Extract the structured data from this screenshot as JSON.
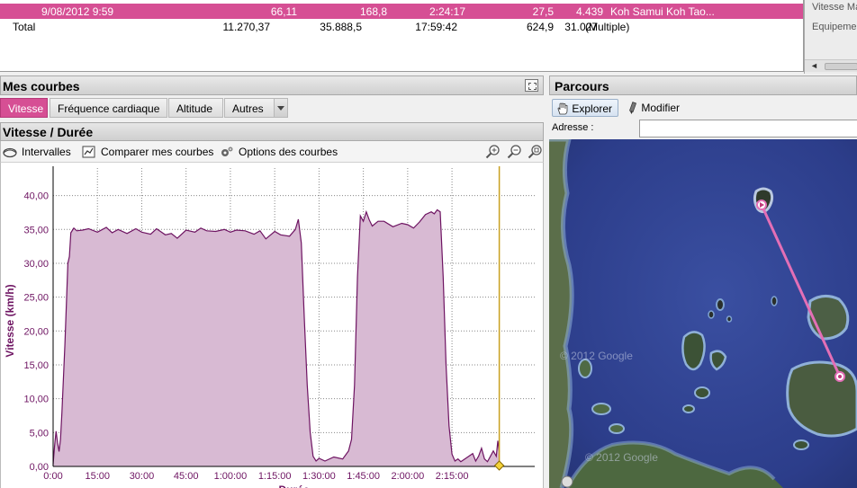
{
  "table": {
    "selected_row": {
      "date": "9/08/2012 9:59",
      "c1": "66,11",
      "c2": "168,8",
      "c3": "2:24:17",
      "c4": "27,5",
      "c5": "4.439",
      "c6": "Koh Samui  Koh Tao..."
    },
    "total_row": {
      "label": "Total",
      "c1": "11.270,37",
      "c2": "35.888,5",
      "c3": "17:59:42",
      "c4": "624,9",
      "c5": "31.027",
      "c6": "(Multiple)"
    }
  },
  "side_panel": {
    "label1": "Vitesse Ma",
    "label2": "Equipemen"
  },
  "mes_courbes": {
    "title": "Mes courbes",
    "tabs": [
      "Vitesse",
      "Fréquence cardiaque",
      "Altitude",
      "Autres"
    ]
  },
  "chart_panel": {
    "title": "Vitesse / Durée",
    "toolbar": {
      "intervalles": "Intervalles",
      "comparer": "Comparer mes courbes",
      "options": "Options des courbes"
    }
  },
  "parcours": {
    "title": "Parcours",
    "explorer": "Explorer",
    "modifier": "Modifier",
    "adresse_label": "Adresse :",
    "adresse_value": "",
    "watermark1": "© 2012 Google",
    "watermark2": "© 2012 Google"
  },
  "colors": {
    "accent": "#d64f94",
    "series_line": "#6e1462",
    "series_fill": "#d8bad3",
    "axis_text": "#6e1462",
    "route": "#e36fb6"
  },
  "chart_data": {
    "type": "area",
    "title": "",
    "xlabel": "Durée",
    "ylabel": "Vitesse (km/h)",
    "x_unit": "minutes",
    "xlim": [
      0,
      163
    ],
    "ylim": [
      0,
      43
    ],
    "xticks": [
      "0:00",
      "15:00",
      "30:00",
      "45:00",
      "1:00:00",
      "1:15:00",
      "1:30:00",
      "1:45:00",
      "2:00:00",
      "2:15:00"
    ],
    "yticks": [
      "0,00",
      "5,00",
      "10,00",
      "15,00",
      "20,00",
      "25,00",
      "30,00",
      "35,00",
      "40,00"
    ],
    "grid": true,
    "x": [
      0,
      0.5,
      1,
      1.5,
      2,
      2.5,
      3,
      4,
      5,
      5.5,
      6,
      7,
      8,
      10,
      12,
      15,
      18,
      20,
      22,
      25,
      28,
      30,
      33,
      35,
      38,
      40,
      42,
      45,
      48,
      50,
      52,
      55,
      58,
      60,
      62,
      65,
      68,
      70,
      72,
      75,
      77,
      80,
      82,
      83,
      84,
      85,
      86,
      87,
      88,
      89,
      90,
      92,
      95,
      98,
      100,
      101,
      102,
      103,
      104,
      105,
      106,
      107,
      108,
      110,
      112,
      115,
      118,
      120,
      122,
      124,
      126,
      128,
      129,
      130,
      131,
      132,
      133,
      134,
      135,
      136,
      137,
      138,
      140,
      142,
      143,
      144,
      145,
      146,
      147,
      148,
      149,
      150,
      150.5,
      151
    ],
    "series": [
      {
        "values": [
          0.3,
          3,
          5.2,
          3.5,
          2.2,
          4,
          8,
          18,
          30,
          31,
          34.5,
          35.2,
          34.8,
          34.9,
          35.1,
          34.6,
          35.3,
          34.5,
          35,
          34.4,
          35.1,
          34.6,
          34.3,
          35.1,
          34.2,
          34.4,
          33.7,
          34.9,
          34.6,
          35.2,
          34.8,
          34.7,
          35,
          34.6,
          34.9,
          34.8,
          34.3,
          34.8,
          33.6,
          34.7,
          34.2,
          34,
          35,
          36.5,
          33,
          22,
          12,
          5,
          1.5,
          0.8,
          1.2,
          0.8,
          1.4,
          1.1,
          2.3,
          4,
          12,
          28,
          37,
          36.2,
          37.6,
          36.4,
          35.5,
          36.2,
          36.2,
          35.4,
          35.9,
          35.7,
          35.2,
          36.1,
          37.2,
          37.6,
          37.3,
          37.9,
          37.6,
          28,
          15,
          6,
          1.8,
          0.8,
          1.1,
          0.7,
          1.3,
          1.9,
          0.8,
          1.5,
          2.7,
          1.1,
          0.7,
          1.5,
          2.3,
          1.5,
          3.8,
          2.2
        ]
      }
    ],
    "cursor_x": 151
  }
}
